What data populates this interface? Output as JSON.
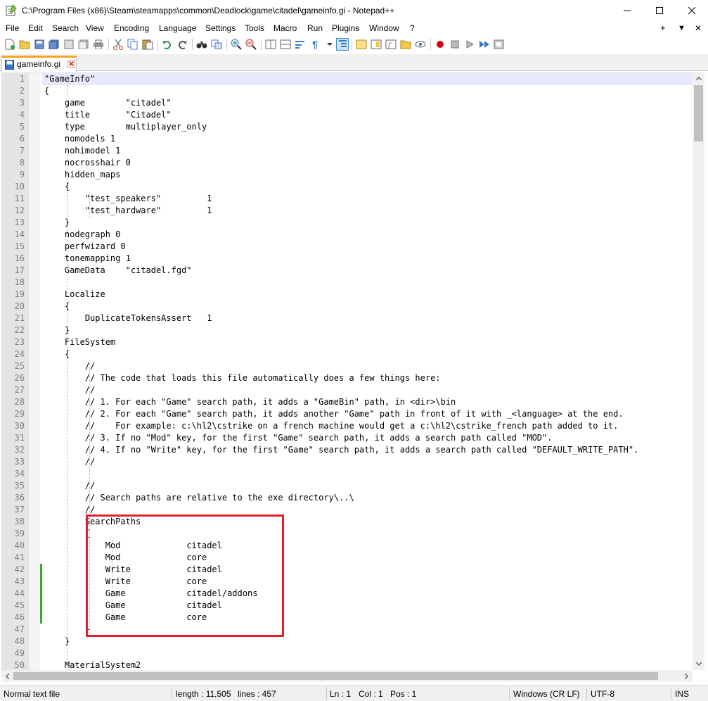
{
  "window": {
    "title": "C:\\Program Files (x86)\\Steam\\steamapps\\common\\Deadlock\\game\\citadel\\gameinfo.gi - Notepad++"
  },
  "menu": {
    "items": [
      "File",
      "Edit",
      "Search",
      "View",
      "Encoding",
      "Language",
      "Settings",
      "Tools",
      "Macro",
      "Run",
      "Plugins",
      "Window",
      "?"
    ],
    "right": {
      "plus": "+",
      "dropdown": "▼",
      "close": "✕"
    }
  },
  "tab": {
    "label": "gameinfo.gi"
  },
  "editor": {
    "lines": [
      "\"GameInfo\"",
      "{",
      "    game        \"citadel\"",
      "    title       \"Citadel\"",
      "    type        multiplayer_only",
      "    nomodels 1",
      "    nohimodel 1",
      "    nocrosshair 0",
      "    hidden_maps",
      "    {",
      "        \"test_speakers\"         1",
      "        \"test_hardware\"         1",
      "    }",
      "    nodegraph 0",
      "    perfwizard 0",
      "    tonemapping 1",
      "    GameData    \"citadel.fgd\"",
      "",
      "    Localize",
      "    {",
      "        DuplicateTokensAssert   1",
      "    }",
      "    FileSystem",
      "    {",
      "        //",
      "        // The code that loads this file automatically does a few things here:",
      "        //",
      "        // 1. For each \"Game\" search path, it adds a \"GameBin\" path, in <dir>\\bin",
      "        // 2. For each \"Game\" search path, it adds another \"Game\" path in front of it with _<language> at the end.",
      "        //    For example: c:\\hl2\\cstrike on a french machine would get a c:\\hl2\\cstrike_french path added to it.",
      "        // 3. If no \"Mod\" key, for the first \"Game\" search path, it adds a search path called \"MOD\".",
      "        // 4. If no \"Write\" key, for the first \"Game\" search path, it adds a search path called \"DEFAULT_WRITE_PATH\".",
      "        //",
      "",
      "        //",
      "        // Search paths are relative to the exe directory\\..\\",
      "        //",
      "        SearchPaths",
      "        {",
      "            Mod             citadel",
      "            Mod             core",
      "            Write           citadel",
      "            Write           core",
      "            Game            citadel/addons",
      "            Game            citadel",
      "            Game            core",
      "        }",
      "    }",
      "",
      "    MaterialSystem2"
    ]
  },
  "status": {
    "file_type": "Normal text file",
    "length": "length : 11,505",
    "lines": "lines : 457",
    "ln": "Ln : 1",
    "col": "Col : 1",
    "pos": "Pos : 1",
    "eol": "Windows (CR LF)",
    "encoding": "UTF-8",
    "mode": "INS"
  },
  "colors": {
    "current_line": "#e8e8ff",
    "highlight_box": "#e3202a",
    "change_marker": "#3ea53e",
    "tab_accent": "#f5a623"
  }
}
